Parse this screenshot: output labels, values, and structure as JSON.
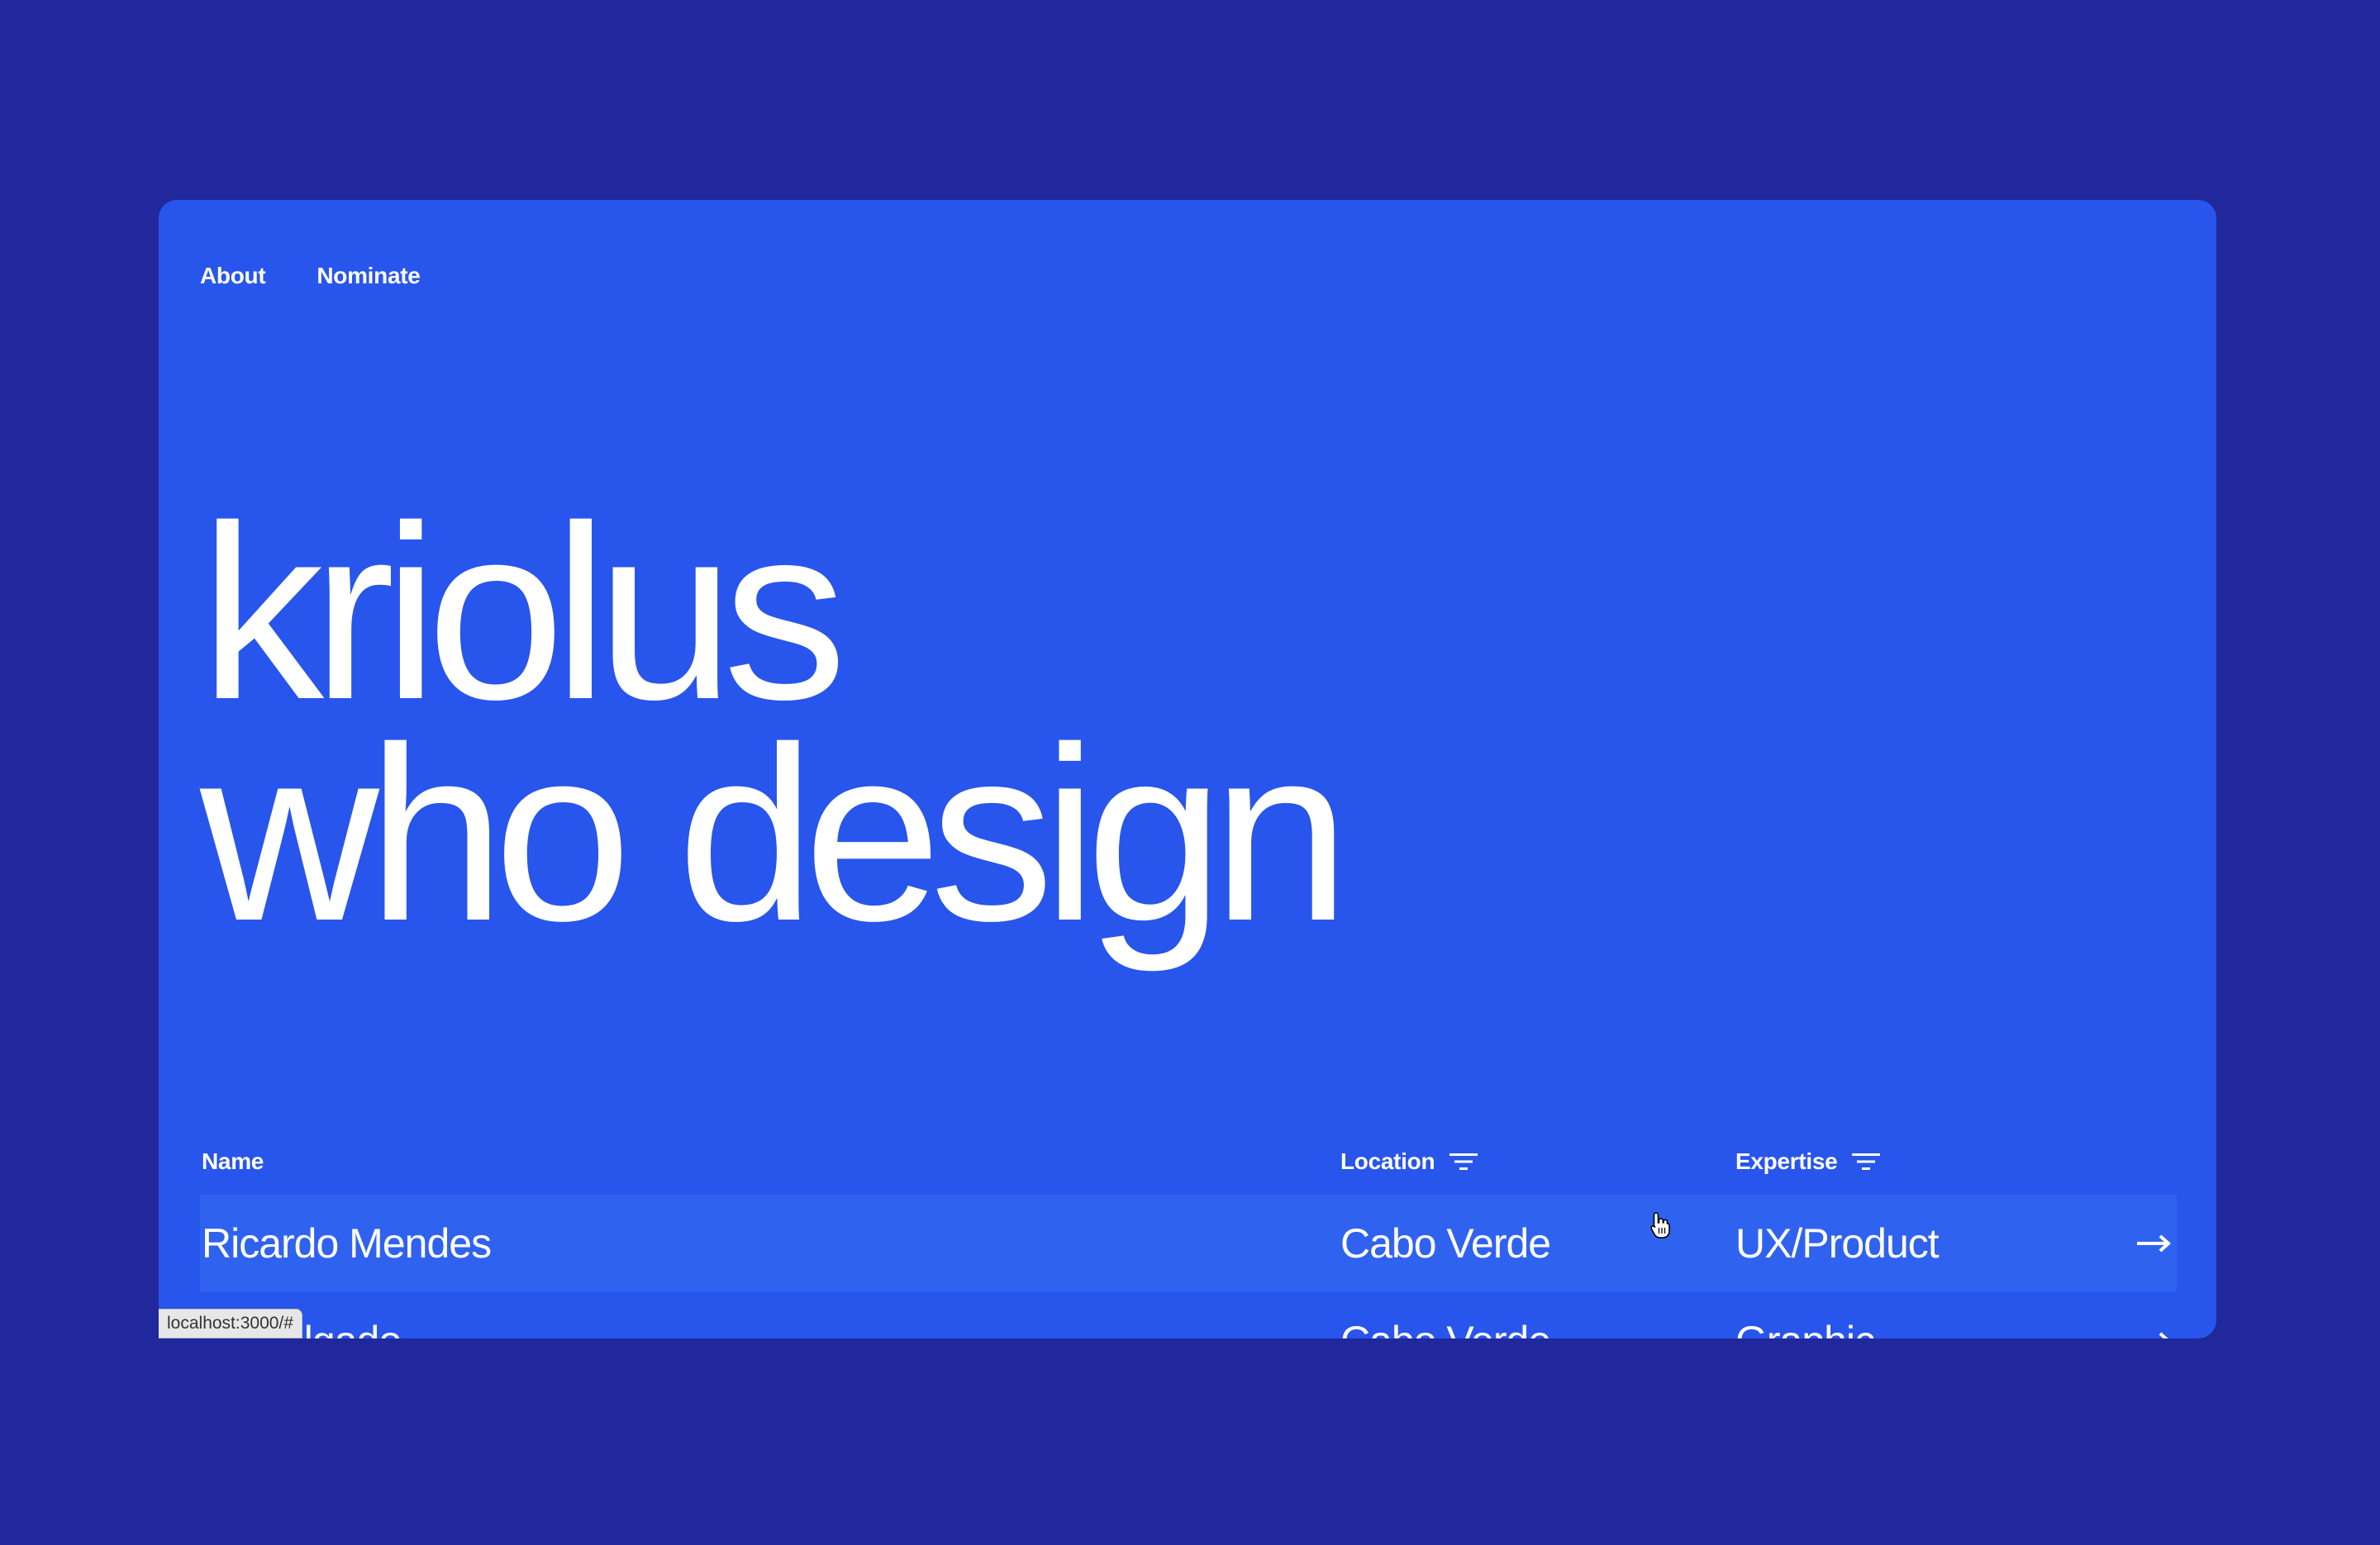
{
  "nav": {
    "about": "About",
    "nominate": "Nominate"
  },
  "hero": {
    "line1": "kriolus",
    "line2": "who design"
  },
  "table": {
    "columns": {
      "name": "Name",
      "location": "Location",
      "expertise": "Expertise"
    },
    "rows": [
      {
        "name": "Ricardo Mendes",
        "location": "Cabo Verde",
        "expertise": "UX/Product"
      },
      {
        "name": "… Delgado",
        "location": "Cabo Verde",
        "expertise": "Graphic"
      }
    ]
  },
  "status_bar": {
    "url": "localhost:3000/#"
  },
  "icons": {
    "filter": "filter-icon",
    "arrow": "arrow-right-icon",
    "cursor": "hand-pointer-cursor"
  },
  "colors": {
    "outer_background": "#20289c",
    "card_background": "#2855ec",
    "row_highlight": "#3062f0",
    "text": "#ffffff"
  }
}
